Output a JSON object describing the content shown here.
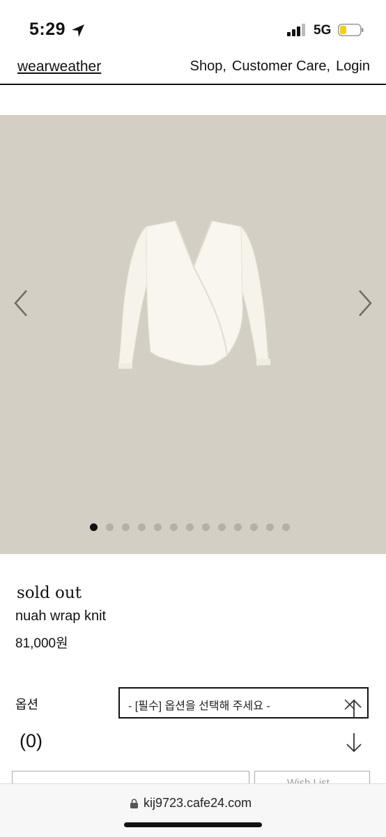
{
  "status_bar": {
    "time": "5:29",
    "network": "5G",
    "battery_color": "#f2cf1c"
  },
  "header": {
    "brand": "wearweather",
    "nav": [
      {
        "label": "Shop,"
      },
      {
        "label": "Customer Care,"
      },
      {
        "label": "Login"
      }
    ]
  },
  "carousel": {
    "background": "#d4cfc4",
    "image": "white-v-neck-wrap-knit",
    "total_slides": 13,
    "active_slide": 1
  },
  "product": {
    "status": "sold out",
    "name": "nuah wrap knit",
    "price": "81,000원"
  },
  "options": {
    "label": "옵션",
    "select_placeholder": "- [필수] 옵션을 선택해 주세요 -"
  },
  "quantity": {
    "count": "(0)"
  },
  "actions": {
    "wishlist_label": "Wish List"
  },
  "browser": {
    "url": "kij9723.cafe24.com"
  }
}
